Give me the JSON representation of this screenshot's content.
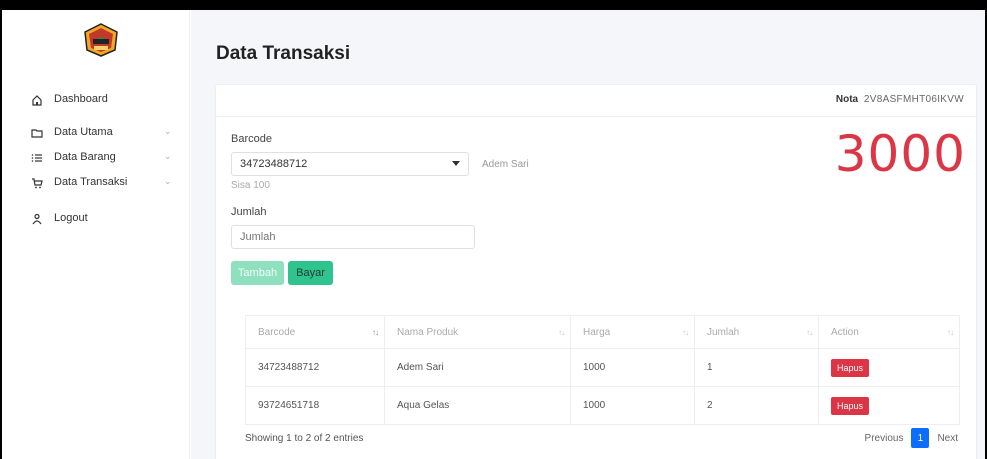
{
  "sidebar": {
    "items": [
      {
        "label": "Dashboard",
        "icon": "home-icon",
        "chevron": false
      },
      {
        "label": "Data Utama",
        "icon": "folder-icon",
        "chevron": true
      },
      {
        "label": "Data Barang",
        "icon": "list-icon",
        "chevron": true
      },
      {
        "label": "Data Transaksi",
        "icon": "cart-icon",
        "chevron": true
      },
      {
        "label": "Logout",
        "icon": "user-icon",
        "chevron": false
      }
    ]
  },
  "page": {
    "title": "Data Transaksi"
  },
  "nota": {
    "label": "Nota",
    "value": "2V8ASFMHT06IKVW"
  },
  "total": "3000",
  "form": {
    "barcode_label": "Barcode",
    "barcode_value": "34723488712",
    "product_name": "Adem Sari",
    "stock_text": "Sisa 100",
    "jumlah_label": "Jumlah",
    "jumlah_placeholder": "Jumlah",
    "tambah_label": "Tambah",
    "bayar_label": "Bayar"
  },
  "table": {
    "headers": [
      "Barcode",
      "Nama Produk",
      "Harga",
      "Jumlah",
      "Action"
    ],
    "rows": [
      {
        "barcode": "34723488712",
        "nama": "Adem Sari",
        "harga": "1000",
        "jumlah": "1",
        "action": "Hapus"
      },
      {
        "barcode": "93724651718",
        "nama": "Aqua Gelas",
        "harga": "1000",
        "jumlah": "2",
        "action": "Hapus"
      }
    ],
    "info": "Showing 1 to 2 of 2 entries",
    "pagination": {
      "previous": "Previous",
      "current": "1",
      "next": "Next"
    }
  },
  "colors": {
    "total": "#dc3545",
    "bayar": "#2fc48d",
    "tambah": "#8ee0bf",
    "hapus": "#dc3545",
    "page_active": "#0d6efd"
  }
}
